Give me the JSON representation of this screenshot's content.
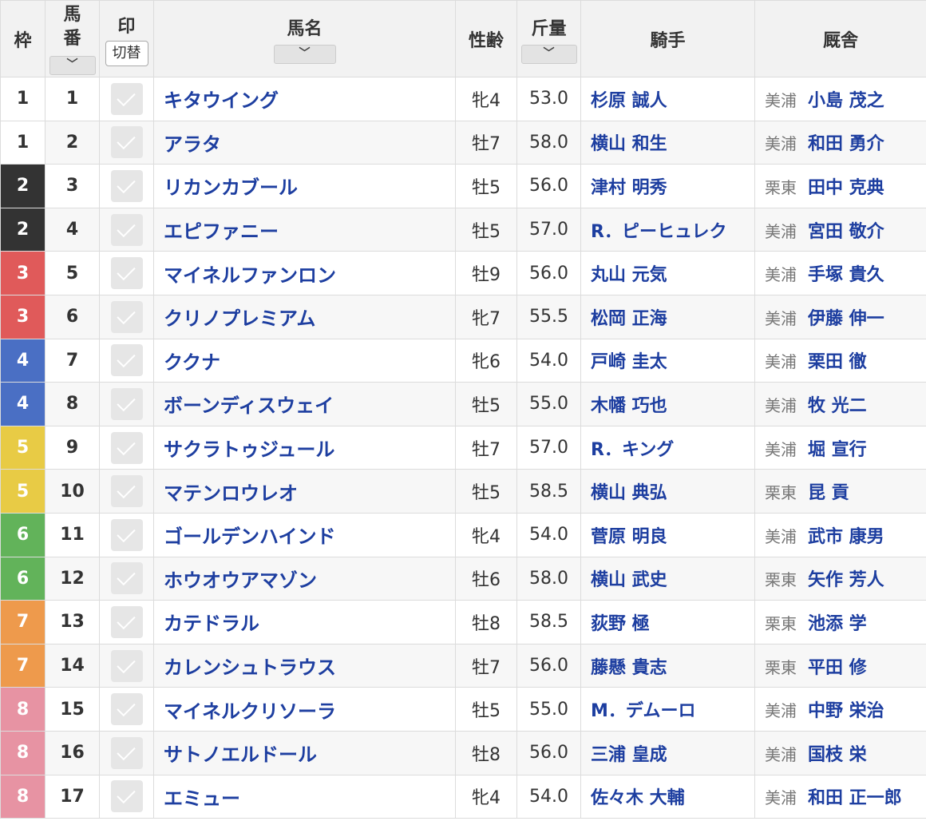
{
  "header": {
    "waku": "枠",
    "umaban_top": "馬",
    "umaban_bottom": "番",
    "mark": "印",
    "mark_switch": "切替",
    "name": "馬名",
    "sex_age": "性齢",
    "weight": "斤量",
    "jockey": "騎手",
    "stable": "厩舎",
    "sort_icon": "chevron-down-icon"
  },
  "waku_colors": {
    "1": {
      "bg": "#ffffff",
      "fg": "#333333"
    },
    "2": {
      "bg": "#333333",
      "fg": "#ffffff"
    },
    "3": {
      "bg": "#e05a5a",
      "fg": "#ffffff"
    },
    "4": {
      "bg": "#4a6fc4",
      "fg": "#ffffff"
    },
    "5": {
      "bg": "#e8cb45",
      "fg": "#ffffff"
    },
    "6": {
      "bg": "#62b35a",
      "fg": "#ffffff"
    },
    "7": {
      "bg": "#ee9a4c",
      "fg": "#ffffff"
    },
    "8": {
      "bg": "#e793a3",
      "fg": "#ffffff"
    }
  },
  "rows": [
    {
      "waku": "1",
      "num": "1",
      "name": "キタウイング",
      "sex_age": "牝4",
      "weight": "53.0",
      "jockey": "杉原 誠人",
      "region": "美浦",
      "trainer": "小島 茂之"
    },
    {
      "waku": "1",
      "num": "2",
      "name": "アラタ",
      "sex_age": "牡7",
      "weight": "58.0",
      "jockey": "横山 和生",
      "region": "美浦",
      "trainer": "和田 勇介"
    },
    {
      "waku": "2",
      "num": "3",
      "name": "リカンカブール",
      "sex_age": "牡5",
      "weight": "56.0",
      "jockey": "津村 明秀",
      "region": "栗東",
      "trainer": "田中 克典"
    },
    {
      "waku": "2",
      "num": "4",
      "name": "エピファニー",
      "sex_age": "牡5",
      "weight": "57.0",
      "jockey": "R．ピーヒュレク",
      "region": "美浦",
      "trainer": "宮田 敬介"
    },
    {
      "waku": "3",
      "num": "5",
      "name": "マイネルファンロン",
      "sex_age": "牡9",
      "weight": "56.0",
      "jockey": "丸山 元気",
      "region": "美浦",
      "trainer": "手塚 貴久"
    },
    {
      "waku": "3",
      "num": "6",
      "name": "クリノプレミアム",
      "sex_age": "牝7",
      "weight": "55.5",
      "jockey": "松岡 正海",
      "region": "美浦",
      "trainer": "伊藤 伸一"
    },
    {
      "waku": "4",
      "num": "7",
      "name": "ククナ",
      "sex_age": "牝6",
      "weight": "54.0",
      "jockey": "戸崎 圭太",
      "region": "美浦",
      "trainer": "栗田 徹"
    },
    {
      "waku": "4",
      "num": "8",
      "name": "ボーンディスウェイ",
      "sex_age": "牡5",
      "weight": "55.0",
      "jockey": "木幡 巧也",
      "region": "美浦",
      "trainer": "牧 光二"
    },
    {
      "waku": "5",
      "num": "9",
      "name": "サクラトゥジュール",
      "sex_age": "牡7",
      "weight": "57.0",
      "jockey": "R．キング",
      "region": "美浦",
      "trainer": "堀 宣行"
    },
    {
      "waku": "5",
      "num": "10",
      "name": "マテンロウレオ",
      "sex_age": "牡5",
      "weight": "58.5",
      "jockey": "横山 典弘",
      "region": "栗東",
      "trainer": "昆 貢"
    },
    {
      "waku": "6",
      "num": "11",
      "name": "ゴールデンハインド",
      "sex_age": "牝4",
      "weight": "54.0",
      "jockey": "菅原 明良",
      "region": "美浦",
      "trainer": "武市 康男"
    },
    {
      "waku": "6",
      "num": "12",
      "name": "ホウオウアマゾン",
      "sex_age": "牡6",
      "weight": "58.0",
      "jockey": "横山 武史",
      "region": "栗東",
      "trainer": "矢作 芳人"
    },
    {
      "waku": "7",
      "num": "13",
      "name": "カテドラル",
      "sex_age": "牡8",
      "weight": "58.5",
      "jockey": "荻野 極",
      "region": "栗東",
      "trainer": "池添 学"
    },
    {
      "waku": "7",
      "num": "14",
      "name": "カレンシュトラウス",
      "sex_age": "牡7",
      "weight": "56.0",
      "jockey": "藤懸 貴志",
      "region": "栗東",
      "trainer": "平田 修"
    },
    {
      "waku": "8",
      "num": "15",
      "name": "マイネルクリソーラ",
      "sex_age": "牡5",
      "weight": "55.0",
      "jockey": "M．デムーロ",
      "region": "美浦",
      "trainer": "中野 栄治"
    },
    {
      "waku": "8",
      "num": "16",
      "name": "サトノエルドール",
      "sex_age": "牡8",
      "weight": "56.0",
      "jockey": "三浦 皇成",
      "region": "美浦",
      "trainer": "国枝 栄"
    },
    {
      "waku": "8",
      "num": "17",
      "name": "エミュー",
      "sex_age": "牝4",
      "weight": "54.0",
      "jockey": "佐々木 大輔",
      "region": "美浦",
      "trainer": "和田 正一郎"
    }
  ]
}
